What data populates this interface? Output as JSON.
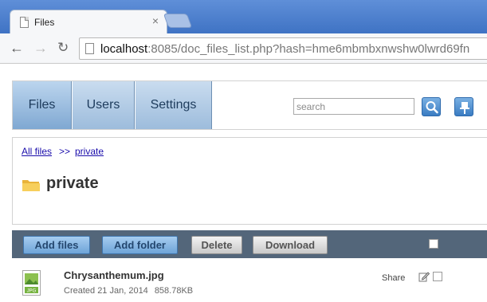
{
  "browser": {
    "tab_title": "Files",
    "tab_close": "×",
    "url_host": "localhost",
    "url_rest": ":8085/doc_files_list.php?hash=hme6mbmbxnwshw0lwrd69fn"
  },
  "menu": {
    "tabs": [
      {
        "label": "Files",
        "active": true
      },
      {
        "label": "Users",
        "active": false
      },
      {
        "label": "Settings",
        "active": false
      }
    ],
    "search_placeholder": "search"
  },
  "breadcrumb": {
    "root": "All files",
    "separator": ">>",
    "current": "private"
  },
  "folder": {
    "title": "private"
  },
  "actions": {
    "add_files": "Add files",
    "add_folder": "Add folder",
    "delete": "Delete",
    "download": "Download"
  },
  "files": [
    {
      "name": "Chrysanthemum.jpg",
      "created": "Created 21 Jan, 2014",
      "size": "858.78KB",
      "share": "Share",
      "thumb_label": "JPG"
    }
  ],
  "colors": {
    "tabstrip": "#3f73c4",
    "menu_tab": "#9dbcdc",
    "action_bar": "#53667a",
    "link": "#1a0dab",
    "primary_button": "#6ea4d8"
  },
  "icons": {
    "back": "back-arrow-icon",
    "forward": "forward-arrow-icon",
    "reload": "reload-icon",
    "search": "magnifier-icon",
    "pin": "pushpin-icon",
    "folder": "folder-icon",
    "file": "jpg-file-icon",
    "edit": "edit-icon"
  }
}
